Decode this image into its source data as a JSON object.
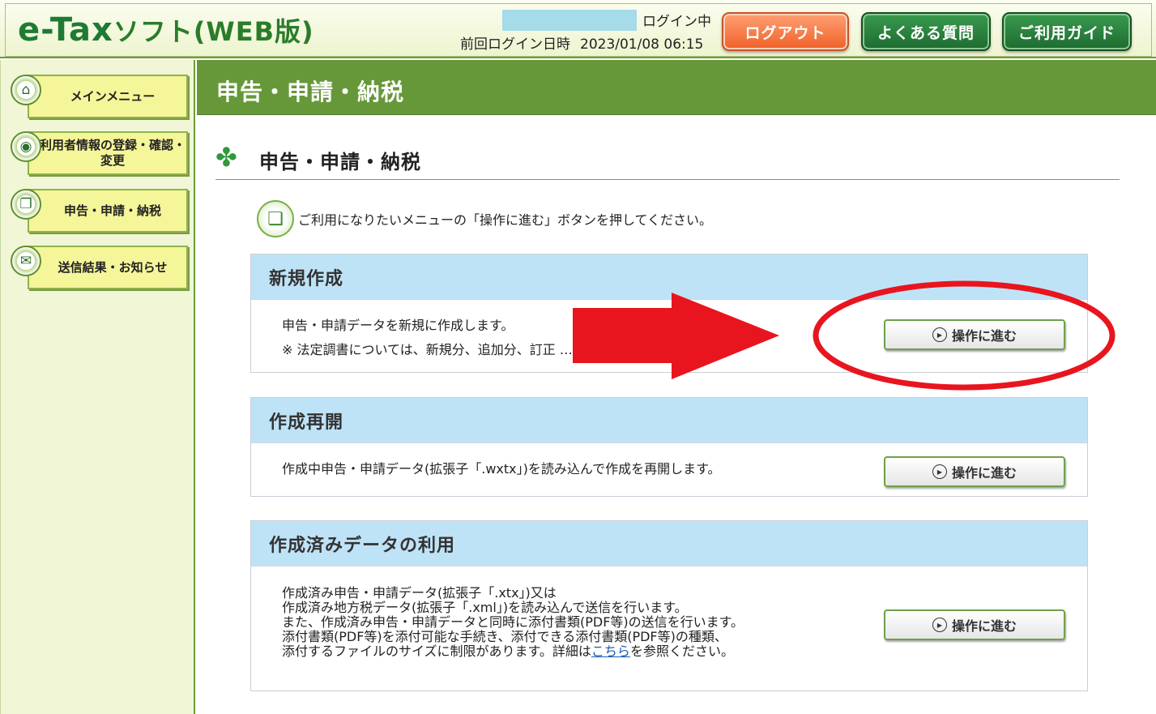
{
  "header": {
    "logo_main": "e-Tax",
    "logo_sub": "ソフト(WEB版)",
    "login_status": "ログイン中",
    "login_last_label": "前回ログイン日時",
    "login_last_value": "2023/01/08 06:15",
    "buttons": {
      "logout": "ログアウト",
      "faq": "よくある質問",
      "guide": "ご利用ガイド"
    }
  },
  "sidebar": {
    "items": [
      {
        "label": "メインメニュー",
        "icon": "home-icon"
      },
      {
        "label": "利用者情報の登録・確認・変更",
        "icon": "user-info-icon"
      },
      {
        "label": "申告・申請・納税",
        "icon": "document-icon"
      },
      {
        "label": "送信結果・お知らせ",
        "icon": "mail-icon"
      }
    ]
  },
  "page": {
    "header_title": "申告・申請・納税",
    "section_title": "申告・申請・納税",
    "instruction": "ご利用になりたいメニューの「操作に進む」ボタンを押してください。"
  },
  "panels": [
    {
      "title": "新規作成",
      "lines": [
        "申告・申請データを新規に作成します。",
        "※ 法定調書については、新規分、追加分、訂正 … 能です。"
      ],
      "button": "操作に進む"
    },
    {
      "title": "作成再開",
      "lines": [
        "作成中申告・申請データ(拡張子「.wxtx」)を読み込んで作成を再開します。"
      ],
      "button": "操作に進む"
    },
    {
      "title": "作成済みデータの利用",
      "lines": [
        "作成済み申告・申請データ(拡張子「.xtx」)又は",
        "作成済み地方税データ(拡張子「.xml」)を読み込んで送信を行います。",
        "また、作成済み申告・申請データと同時に添付書類(PDF等)の送信を行います。",
        "添付書類(PDF等)を添付可能な手続き、添付できる添付書類(PDF等)の種類、",
        "添付するファイルのサイズに制限があります。詳細は"
      ],
      "link_text": "こちら",
      "link_tail": "を参照ください。",
      "button": "操作に進む"
    }
  ],
  "colors": {
    "header_green": "#66983a",
    "panel_header": "#bfe3f6",
    "annotation_red": "#e8151f"
  }
}
